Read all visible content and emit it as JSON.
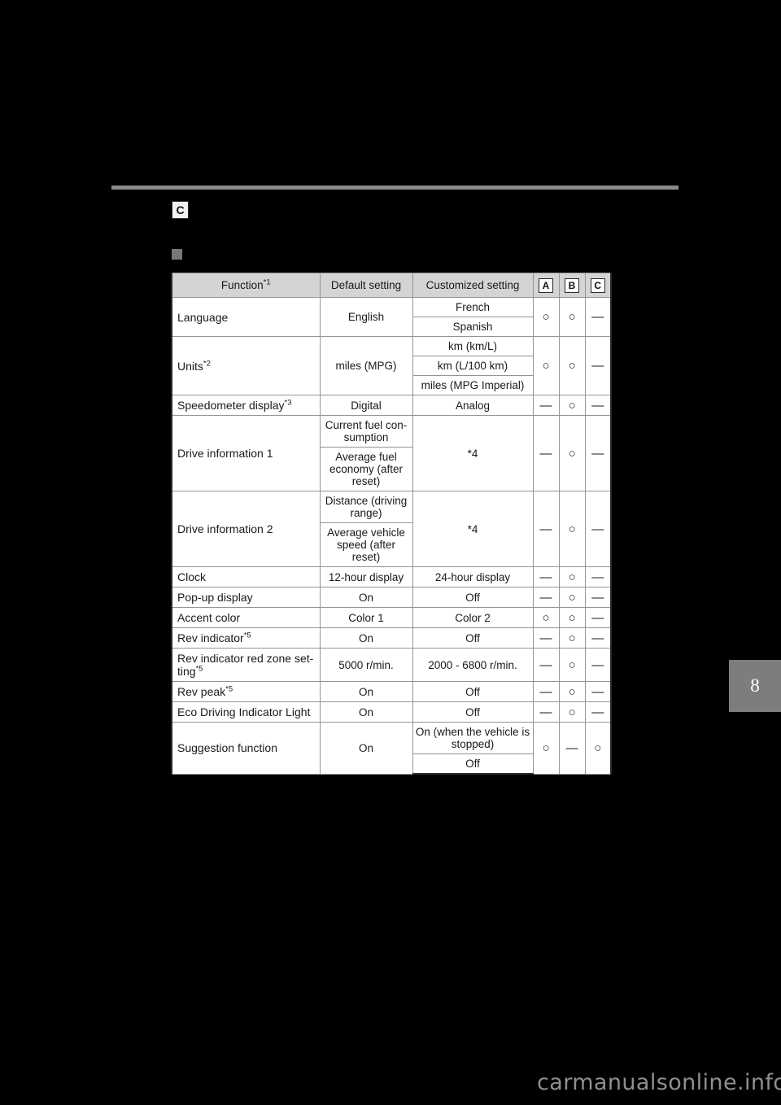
{
  "page": {
    "section_badge": "C",
    "page_number": "8",
    "watermark": "carmanualsonline.info"
  },
  "table": {
    "headers": {
      "function": "Function",
      "function_note": "*1",
      "default_setting": "Default setting",
      "customized_setting": "Customized setting",
      "col_a": "A",
      "col_b": "B",
      "col_c": "C"
    },
    "rows": [
      {
        "function": "Language",
        "function_note": "",
        "default": [
          "English"
        ],
        "customized": [
          "French",
          "Spanish"
        ],
        "a": "○",
        "b": "○",
        "c": "—"
      },
      {
        "function": "Units",
        "function_note": "*2",
        "default": [
          "miles (MPG)"
        ],
        "customized": [
          "km (km/L)",
          "km (L/100 km)",
          "miles (MPG Imperial)"
        ],
        "a": "○",
        "b": "○",
        "c": "—"
      },
      {
        "function": "Speedometer display",
        "function_note": "*3",
        "default": [
          "Digital"
        ],
        "customized": [
          "Analog"
        ],
        "a": "—",
        "b": "○",
        "c": "—"
      },
      {
        "function": "Drive information 1",
        "function_note": "",
        "default": [
          "Current fuel con-sumption",
          "Average fuel economy (after reset)"
        ],
        "customized": [
          "*4"
        ],
        "a": "—",
        "b": "○",
        "c": "—"
      },
      {
        "function": "Drive information 2",
        "function_note": "",
        "default": [
          "Distance (driving range)",
          "Average vehicle speed (after reset)"
        ],
        "customized": [
          "*4"
        ],
        "a": "—",
        "b": "○",
        "c": "—"
      },
      {
        "function": "Clock",
        "function_note": "",
        "default": [
          "12-hour display"
        ],
        "customized": [
          "24-hour display"
        ],
        "a": "—",
        "b": "○",
        "c": "—"
      },
      {
        "function": "Pop-up display",
        "function_note": "",
        "default": [
          "On"
        ],
        "customized": [
          "Off"
        ],
        "a": "—",
        "b": "○",
        "c": "—"
      },
      {
        "function": "Accent color",
        "function_note": "",
        "default": [
          "Color 1"
        ],
        "customized": [
          "Color 2"
        ],
        "a": "○",
        "b": "○",
        "c": "—"
      },
      {
        "function": "Rev indicator",
        "function_note": "*5",
        "default": [
          "On"
        ],
        "customized": [
          "Off"
        ],
        "a": "—",
        "b": "○",
        "c": "—"
      },
      {
        "function": "Rev indicator red zone set-ting",
        "function_note": "*5",
        "default": [
          "5000 r/min."
        ],
        "customized": [
          "2000 - 6800 r/min."
        ],
        "a": "—",
        "b": "○",
        "c": "—"
      },
      {
        "function": "Rev peak",
        "function_note": "*5",
        "default": [
          "On"
        ],
        "customized": [
          "Off"
        ],
        "a": "—",
        "b": "○",
        "c": "—"
      },
      {
        "function": "Eco Driving Indicator Light",
        "function_note": "",
        "default": [
          "On"
        ],
        "customized": [
          "Off"
        ],
        "a": "—",
        "b": "○",
        "c": "—"
      },
      {
        "function": "Suggestion function",
        "function_note": "",
        "default": [
          "On"
        ],
        "customized": [
          "On (when the vehicle is stopped)",
          "Off"
        ],
        "a": "○",
        "b": "—",
        "c": "○"
      }
    ]
  }
}
